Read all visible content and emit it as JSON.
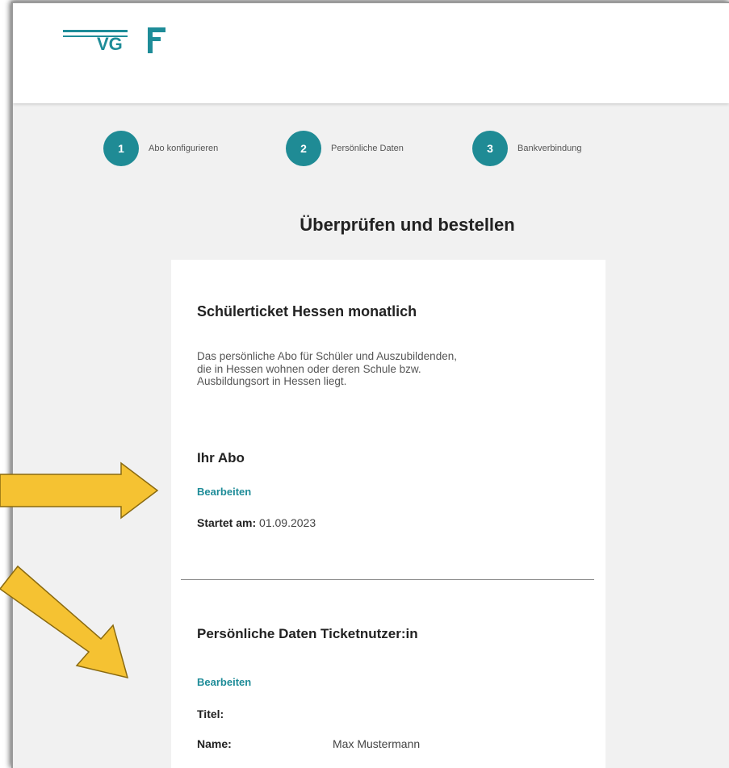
{
  "header": {
    "logo_text": "VG"
  },
  "stepper": {
    "steps": [
      {
        "number": "1",
        "label": "Abo konfigurieren"
      },
      {
        "number": "2",
        "label": "Persönliche Daten"
      },
      {
        "number": "3",
        "label": "Bankverbindung"
      }
    ]
  },
  "page": {
    "title": "Überprüfen und bestellen"
  },
  "card": {
    "product_title": "Schülerticket Hessen monatlich",
    "product_description": "Das persönliche Abo für Schüler und Auszubildenden, die in Hessen wohnen oder deren Schule bzw. Ausbildungsort in Hessen liegt.",
    "abo_section": {
      "heading": "Ihr Abo",
      "edit_label": "Bearbeiten",
      "start_label": "Startet am:",
      "start_value": "01.09.2023"
    },
    "personal_section": {
      "heading": "Persönliche Daten Ticketnutzer:in",
      "edit_label": "Bearbeiten",
      "title_label": "Titel:",
      "title_value": "",
      "name_label": "Name:",
      "name_value": "Max Mustermann"
    }
  },
  "colors": {
    "brand": "#1e8c98",
    "annotation_arrow": "#f5c232",
    "annotation_outline": "#8a6a10"
  }
}
